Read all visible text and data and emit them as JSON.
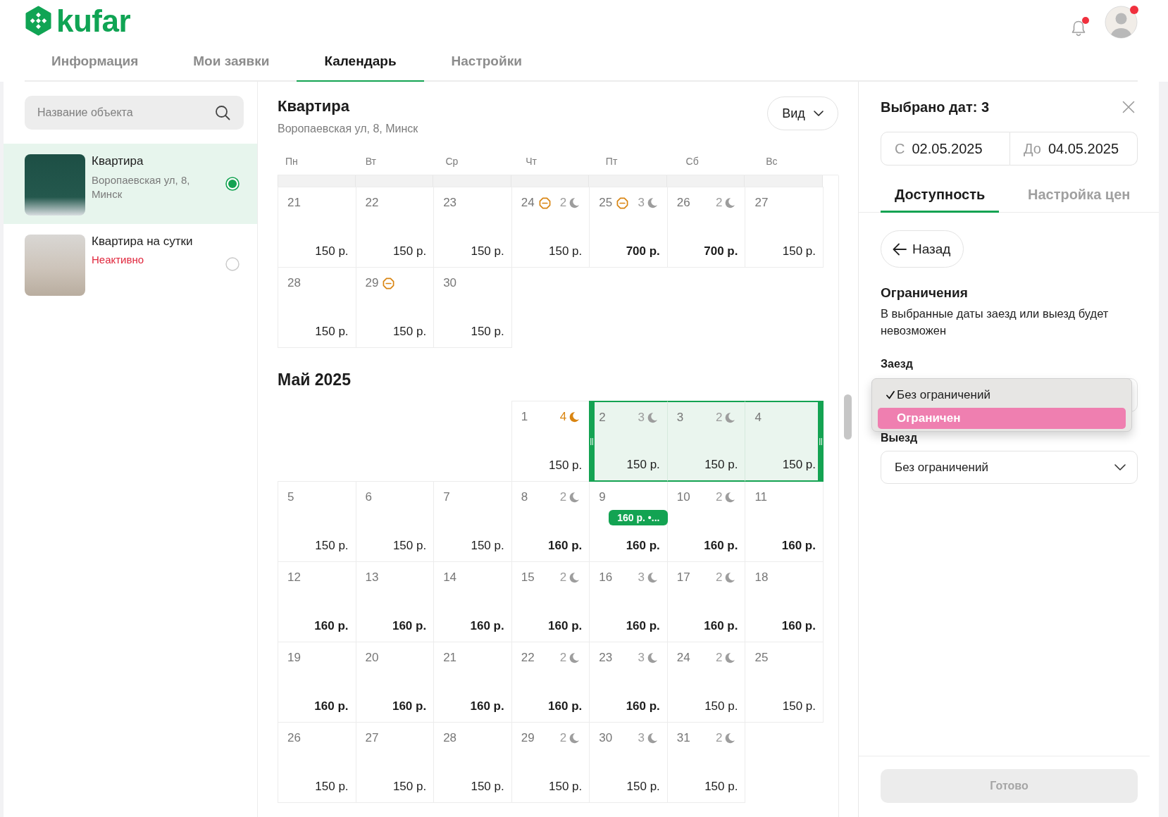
{
  "header": {
    "logo": "kufar",
    "notifications": {
      "unread": true
    },
    "profile": {
      "unread": true
    },
    "tabs": [
      {
        "label": "Информация",
        "selected": false
      },
      {
        "label": "Мои заявки",
        "selected": false
      },
      {
        "label": "Календарь",
        "selected": true
      },
      {
        "label": "Настройки",
        "selected": false
      }
    ]
  },
  "sidebar": {
    "search": {
      "placeholder": "Название объекта"
    },
    "objects": [
      {
        "title": "Квартира",
        "address": "Воропаевская ул, 8, Минск",
        "selected": true
      },
      {
        "title": "Квартира на сутки",
        "status": "Неактивно",
        "selected": false
      }
    ]
  },
  "calendar": {
    "title": "Квартира",
    "address": "Воропаевская ул, 8, Минск",
    "view_button": "Вид",
    "weekdays": [
      "Пн",
      "Вт",
      "Ср",
      "Чт",
      "Пт",
      "Сб",
      "Вс"
    ],
    "months": [
      {
        "weeks": [
          {
            "days": [
              {
                "kind": "day",
                "date": "21",
                "price": "150 р.",
                "price_custom": false,
                "restricted": false,
                "selected": false
              },
              {
                "kind": "day",
                "date": "22",
                "price": "150 р.",
                "price_custom": false,
                "restricted": false,
                "selected": false
              },
              {
                "kind": "day",
                "date": "23",
                "price": "150 р.",
                "price_custom": false,
                "restricted": false,
                "selected": false
              },
              {
                "kind": "day",
                "date": "24",
                "price": "150 р.",
                "price_custom": false,
                "restricted": true,
                "selected": false,
                "nights": "2",
                "nights_alert": false
              },
              {
                "kind": "day",
                "date": "25",
                "price": "700 р.",
                "price_custom": true,
                "restricted": true,
                "selected": false,
                "nights": "3",
                "nights_alert": false
              },
              {
                "kind": "day",
                "date": "26",
                "price": "700 р.",
                "price_custom": true,
                "restricted": false,
                "selected": false,
                "nights": "2",
                "nights_alert": false
              },
              {
                "kind": "day",
                "date": "27",
                "price": "150 р.",
                "price_custom": false,
                "restricted": false,
                "selected": false
              }
            ]
          },
          {
            "days": [
              {
                "kind": "day",
                "date": "28",
                "price": "150 р.",
                "price_custom": false,
                "restricted": false,
                "selected": false
              },
              {
                "kind": "day",
                "date": "29",
                "price": "150 р.",
                "price_custom": false,
                "restricted": true,
                "selected": false
              },
              {
                "kind": "day",
                "date": "30",
                "price": "150 р.",
                "price_custom": false,
                "restricted": false,
                "selected": false
              }
            ]
          }
        ]
      },
      {
        "title": "Май 2025",
        "weeks": [
          {
            "days": [
              {
                "kind": "blank"
              },
              {
                "kind": "blank"
              },
              {
                "kind": "blank"
              },
              {
                "kind": "day",
                "date": "1",
                "price": "150 р.",
                "price_custom": false,
                "restricted": false,
                "selected": false,
                "nights": "4",
                "nights_alert": true
              },
              {
                "kind": "day",
                "date": "2",
                "price": "150 р.",
                "price_custom": false,
                "restricted": false,
                "selected": true,
                "nights": "3",
                "nights_alert": false
              },
              {
                "kind": "day",
                "date": "3",
                "price": "150 р.",
                "price_custom": false,
                "restricted": false,
                "selected": true,
                "nights": "2",
                "nights_alert": false
              },
              {
                "kind": "day",
                "date": "4",
                "price": "150 р.",
                "price_custom": false,
                "restricted": false,
                "selected": true
              }
            ]
          },
          {
            "days": [
              {
                "kind": "day",
                "date": "5",
                "price": "150 р.",
                "price_custom": false,
                "restricted": false,
                "selected": false
              },
              {
                "kind": "day",
                "date": "6",
                "price": "150 р.",
                "price_custom": false,
                "restricted": false,
                "selected": false
              },
              {
                "kind": "day",
                "date": "7",
                "price": "150 р.",
                "price_custom": false,
                "restricted": false,
                "selected": false
              },
              {
                "kind": "day",
                "date": "8",
                "price": "160 р.",
                "price_custom": true,
                "restricted": false,
                "selected": false,
                "nights": "2",
                "nights_alert": false
              },
              {
                "kind": "day",
                "date": "9",
                "price": "160 р.",
                "price_custom": true,
                "restricted": false,
                "selected": false,
                "tag": "160 р. •..."
              },
              {
                "kind": "day",
                "date": "10",
                "price": "160 р.",
                "price_custom": true,
                "restricted": false,
                "selected": false,
                "nights": "2",
                "nights_alert": false
              },
              {
                "kind": "day",
                "date": "11",
                "price": "160 р.",
                "price_custom": true,
                "restricted": false,
                "selected": false
              }
            ]
          },
          {
            "days": [
              {
                "kind": "day",
                "date": "12",
                "price": "160 р.",
                "price_custom": true,
                "restricted": false,
                "selected": false
              },
              {
                "kind": "day",
                "date": "13",
                "price": "160 р.",
                "price_custom": true,
                "restricted": false,
                "selected": false
              },
              {
                "kind": "day",
                "date": "14",
                "price": "160 р.",
                "price_custom": true,
                "restricted": false,
                "selected": false
              },
              {
                "kind": "day",
                "date": "15",
                "price": "160 р.",
                "price_custom": true,
                "restricted": false,
                "selected": false,
                "nights": "2",
                "nights_alert": false
              },
              {
                "kind": "day",
                "date": "16",
                "price": "160 р.",
                "price_custom": true,
                "restricted": false,
                "selected": false,
                "nights": "3",
                "nights_alert": false
              },
              {
                "kind": "day",
                "date": "17",
                "price": "160 р.",
                "price_custom": true,
                "restricted": false,
                "selected": false,
                "nights": "2",
                "nights_alert": false
              },
              {
                "kind": "day",
                "date": "18",
                "price": "160 р.",
                "price_custom": true,
                "restricted": false,
                "selected": false
              }
            ]
          },
          {
            "days": [
              {
                "kind": "day",
                "date": "19",
                "price": "160 р.",
                "price_custom": true,
                "restricted": false,
                "selected": false
              },
              {
                "kind": "day",
                "date": "20",
                "price": "160 р.",
                "price_custom": true,
                "restricted": false,
                "selected": false
              },
              {
                "kind": "day",
                "date": "21",
                "price": "160 р.",
                "price_custom": true,
                "restricted": false,
                "selected": false
              },
              {
                "kind": "day",
                "date": "22",
                "price": "160 р.",
                "price_custom": true,
                "restricted": false,
                "selected": false,
                "nights": "2",
                "nights_alert": false
              },
              {
                "kind": "day",
                "date": "23",
                "price": "160 р.",
                "price_custom": true,
                "restricted": false,
                "selected": false,
                "nights": "3",
                "nights_alert": false
              },
              {
                "kind": "day",
                "date": "24",
                "price": "150 р.",
                "price_custom": false,
                "restricted": false,
                "selected": false,
                "nights": "2",
                "nights_alert": false
              },
              {
                "kind": "day",
                "date": "25",
                "price": "150 р.",
                "price_custom": false,
                "restricted": false,
                "selected": false
              }
            ]
          },
          {
            "days": [
              {
                "kind": "day",
                "date": "26",
                "price": "150 р.",
                "price_custom": false,
                "restricted": false,
                "selected": false
              },
              {
                "kind": "day",
                "date": "27",
                "price": "150 р.",
                "price_custom": false,
                "restricted": false,
                "selected": false
              },
              {
                "kind": "day",
                "date": "28",
                "price": "150 р.",
                "price_custom": false,
                "restricted": false,
                "selected": false
              },
              {
                "kind": "day",
                "date": "29",
                "price": "150 р.",
                "price_custom": false,
                "restricted": false,
                "selected": false,
                "nights": "2",
                "nights_alert": false
              },
              {
                "kind": "day",
                "date": "30",
                "price": "150 р.",
                "price_custom": false,
                "restricted": false,
                "selected": false,
                "nights": "3",
                "nights_alert": false
              },
              {
                "kind": "day",
                "date": "31",
                "price": "150 р.",
                "price_custom": false,
                "restricted": false,
                "selected": false,
                "nights": "2",
                "nights_alert": false
              }
            ]
          }
        ]
      }
    ]
  },
  "selection_panel": {
    "title": "Выбрано дат: 3",
    "date_range": {
      "from_label": "С",
      "from": "02.05.2025",
      "to_label": "До",
      "to": "04.05.2025"
    },
    "tabs": [
      {
        "label": "Доступность",
        "selected": true
      },
      {
        "label": "Настройка цен",
        "selected": false
      }
    ],
    "back_button": "Назад",
    "section_title": "Ограничения",
    "description": "В выбранные даты заезд или выезд будет невозможен",
    "checkin": {
      "label": "Заезд",
      "menu": [
        {
          "label": "Без ограничений",
          "checked": true,
          "selected": false
        },
        {
          "label": "Ограничен",
          "checked": false,
          "selected": true
        }
      ]
    },
    "checkout": {
      "label": "Выезд",
      "value": "Без ограничений"
    },
    "done_button": {
      "label": "Готово",
      "disabled": true
    }
  }
}
